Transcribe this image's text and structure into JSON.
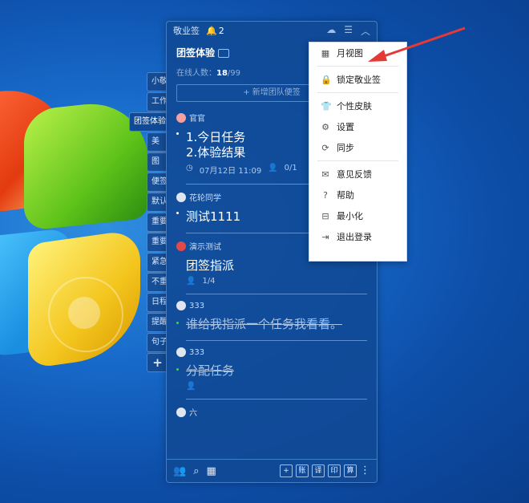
{
  "panel": {
    "title": "敬业签",
    "bell_count": "2",
    "team_name": "团签体验",
    "online_label": "在线人数：",
    "online_count": "18",
    "online_total": "/99",
    "new_button": "+ 新增团队便签"
  },
  "side_tabs": [
    "小敬",
    "工作",
    "团签体验",
    "美",
    "图",
    "便签",
    "默认",
    "重要",
    "重要",
    "紧急",
    "不重",
    "日程",
    "提醒",
    "句子",
    "+"
  ],
  "notes": [
    {
      "author": "官官",
      "line1": "1.今日任务",
      "line2": "2.体验结果",
      "date": "07月12日 11:09",
      "assign": "0/1"
    },
    {
      "author": "花轮同学",
      "line1": "测试1111"
    },
    {
      "author": "演示测试",
      "line1": "团签指派",
      "assign": "1/4"
    },
    {
      "author": "333",
      "line1": "谁给我指派一个任务我看看。"
    },
    {
      "author": "333",
      "line1": "分配任务"
    },
    {
      "author": "六"
    }
  ],
  "bottom": {
    "boxes": [
      "+",
      "账",
      "译",
      "印",
      "算"
    ]
  },
  "menu": {
    "items": [
      {
        "label": "月视图",
        "icon": "calendar-icon"
      },
      {
        "label": "锁定敬业签",
        "icon": "lock-icon"
      },
      {
        "label": "个性皮肤",
        "icon": "shirt-icon"
      },
      {
        "label": "设置",
        "icon": "gear-icon"
      },
      {
        "label": "同步",
        "icon": "sync-icon"
      },
      {
        "label": "意见反馈",
        "icon": "mail-icon"
      },
      {
        "label": "帮助",
        "icon": "help-icon"
      },
      {
        "label": "最小化",
        "icon": "minimize-icon"
      },
      {
        "label": "退出登录",
        "icon": "logout-icon"
      }
    ]
  },
  "colors": {
    "panel_bg": "#104a96",
    "arrow": "#e53935"
  }
}
